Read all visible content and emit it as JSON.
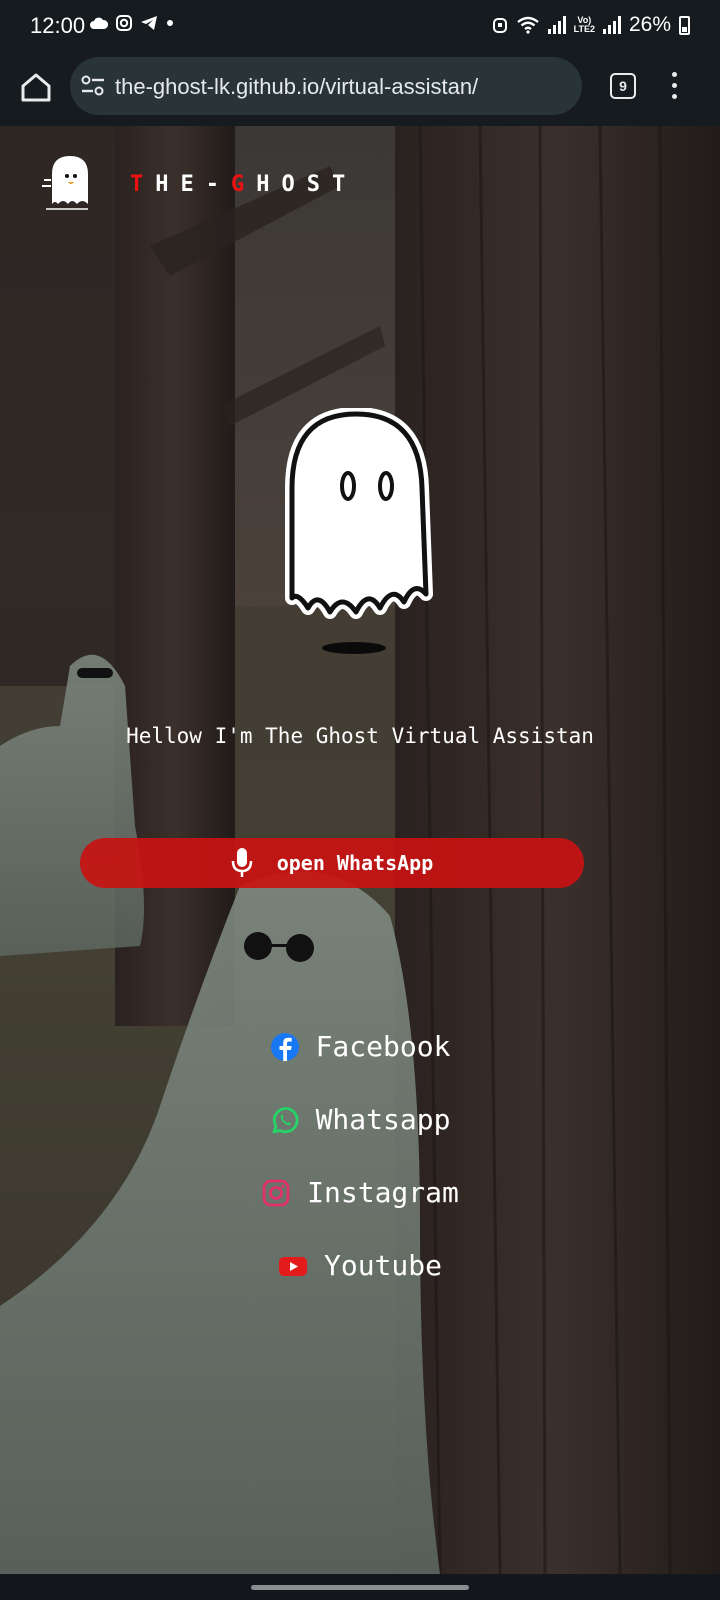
{
  "status_bar": {
    "time": "12:00",
    "battery": "26%"
  },
  "browser": {
    "url": "the-ghost-lk.github.io/virtual-assistan/",
    "tab_count": "9"
  },
  "brand": {
    "letters": [
      "T",
      "H",
      "E",
      "-",
      "G",
      "H",
      "O",
      "S",
      "T"
    ]
  },
  "hero": {
    "greeting": "Hellow I'm The Ghost Virtual Assistan"
  },
  "voice_button": {
    "label": "open WhatsApp",
    "color": "#c81212"
  },
  "social_links": [
    {
      "label": "Facebook",
      "icon": "facebook-icon",
      "color": "#1877f2"
    },
    {
      "label": "Whatsapp",
      "icon": "whatsapp-icon",
      "color": "#25d366"
    },
    {
      "label": "Instagram",
      "icon": "instagram-icon",
      "color": "#e1306c"
    },
    {
      "label": "Youtube",
      "icon": "youtube-icon",
      "color": "#ff0000"
    }
  ]
}
